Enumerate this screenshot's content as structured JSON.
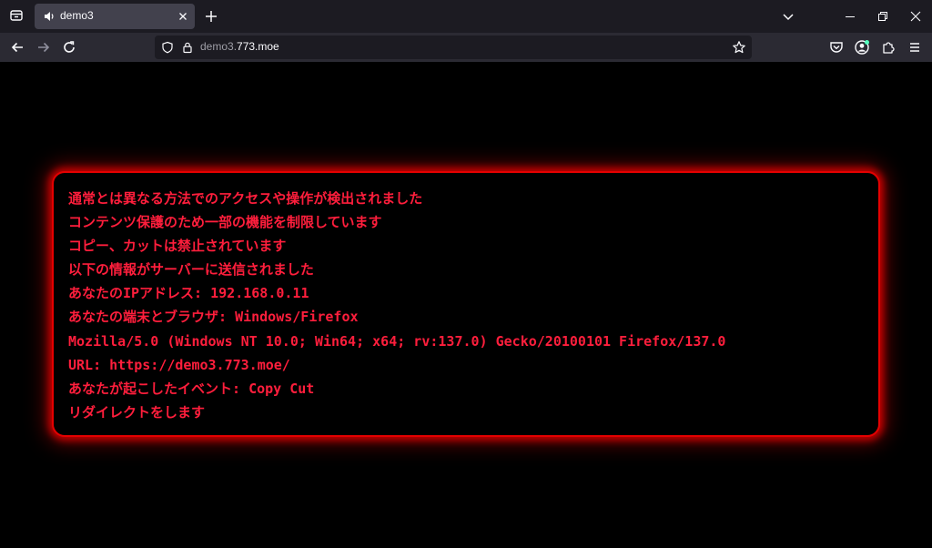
{
  "browser": {
    "tab": {
      "title": "demo3"
    },
    "url": {
      "host_prefix": "demo3.",
      "host_main": "773.moe"
    }
  },
  "colors": {
    "tabbar_bg": "#1c1b22",
    "navbar_bg": "#2b2a33",
    "active_tab_bg": "#42414d",
    "page_bg": "#000000",
    "warning_text": "#ff1e3c",
    "warning_border": "#e40000"
  },
  "icons": {
    "tab_list": "tab-list-icon",
    "tab_audio": "speaker-icon",
    "tab_close": "close-icon",
    "new_tab": "plus-icon",
    "list_all_tabs": "chevron-down-icon",
    "minimize": "minimize-icon",
    "restore": "restore-icon",
    "close_window": "close-icon",
    "back": "back-arrow-icon",
    "forward": "forward-arrow-icon",
    "reload": "reload-icon",
    "tracking_protection": "shield-icon",
    "site_security": "lock-icon",
    "bookmark": "star-icon",
    "pocket": "pocket-icon",
    "account": "account-icon",
    "extensions": "puzzle-icon",
    "menu": "hamburger-menu-icon"
  },
  "warning": {
    "lines": [
      "通常とは異なる方法でのアクセスや操作が検出されました",
      "コンテンツ保護のため一部の機能を制限しています",
      "コピー、カットは禁止されています",
      "以下の情報がサーバーに送信されました",
      "あなたのIPアドレス: 192.168.0.11",
      "あなたの端末とブラウザ: Windows/Firefox",
      "Mozilla/5.0 (Windows NT 10.0; Win64; x64; rv:137.0) Gecko/20100101 Firefox/137.0",
      "URL: https://demo3.773.moe/",
      "あなたが起こしたイベント: Copy Cut",
      "リダイレクトをします"
    ]
  }
}
